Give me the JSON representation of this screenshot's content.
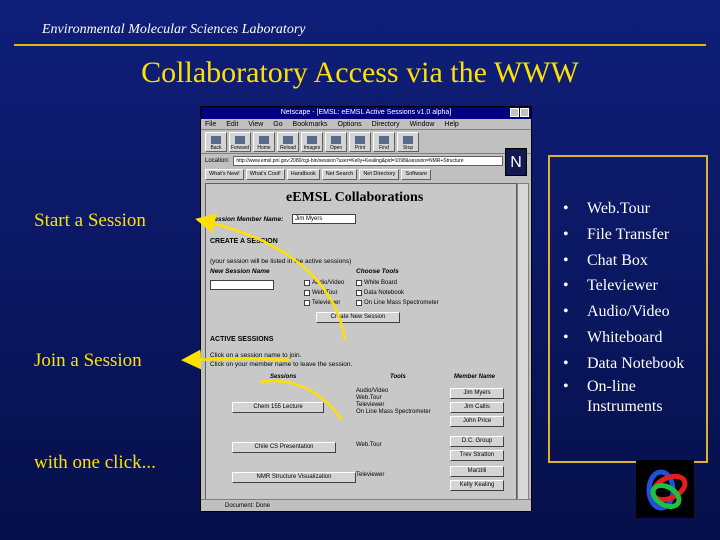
{
  "slide": {
    "lab_name": "Environmental Molecular Sciences Laboratory",
    "title": "Collaboratory Access via the WWW",
    "left_labels": {
      "start": "Start a Session",
      "join": "Join a Session",
      "click": "with one click..."
    },
    "features": [
      "Web.Tour",
      "File Transfer",
      "Chat Box",
      "Televiewer",
      "Audio/Video",
      "Whiteboard",
      "Data Notebook",
      "On-line Instruments"
    ],
    "logo": "emsl-knot-logo"
  },
  "browser": {
    "title": "Netscape - [EMSL: eEMSL Active Sessions v1.0 alpha]",
    "menu": [
      "File",
      "Edit",
      "View",
      "Go",
      "Bookmarks",
      "Options",
      "Directory",
      "Window",
      "Help"
    ],
    "toolbar": [
      "Back",
      "Forward",
      "Home",
      "Reload",
      "Images",
      "Open",
      "Print",
      "Find",
      "Stop"
    ],
    "location_label": "Location:",
    "location_url": "http://www.emsl.pnl.gov:2080/cgi-bin/session?user=Kelly+Kealing&pid=1098&session=NMR+Structure",
    "directory_buttons": [
      "What's New!",
      "What's Cool!",
      "Handbook",
      "Net Search",
      "Net Directory",
      "Software"
    ],
    "status": "Document: Done",
    "page": {
      "title": "eEMSL Collaborations",
      "member_label": "Session Member Name:",
      "member_value": "Jim Myers",
      "create_heading": "CREATE A SESSION",
      "create_note": "(your session will be listed in the active sessions)",
      "new_session_label": "New Session Name",
      "choose_tools_label": "Choose Tools",
      "tools_col1": [
        "Audio/Video",
        "Web.Tour",
        "Televiewer"
      ],
      "tools_col2": [
        "White Board",
        "Data Notebook",
        "On Line Mass Spectrometer"
      ],
      "create_button": "Create New Session",
      "active_heading": "ACTIVE SESSIONS",
      "join_note": "Click on a session name to join.",
      "leave_note": "Click on your member name to leave the session.",
      "col_sessions": "Sessions",
      "col_tools": "Tools",
      "col_member": "Member Name",
      "sessions": [
        {
          "name": "Chem 155 Lecture",
          "tools": [
            "Audio/Video",
            "Web.Tour",
            "Televiewer",
            "On Line Mass Spectrometer"
          ],
          "members": [
            "Jim Myers",
            "Jim Callis",
            "John Price"
          ]
        },
        {
          "name": "Chile CS Presentation",
          "tools": [
            "Web.Tour"
          ],
          "members": [
            "D.C. Group",
            "Trev Stratton"
          ]
        },
        {
          "name": "NMR Structure Visualization",
          "tools": [
            "Televiewer"
          ],
          "members": [
            "Marzilli",
            "Kelly Kealing"
          ]
        }
      ]
    }
  }
}
